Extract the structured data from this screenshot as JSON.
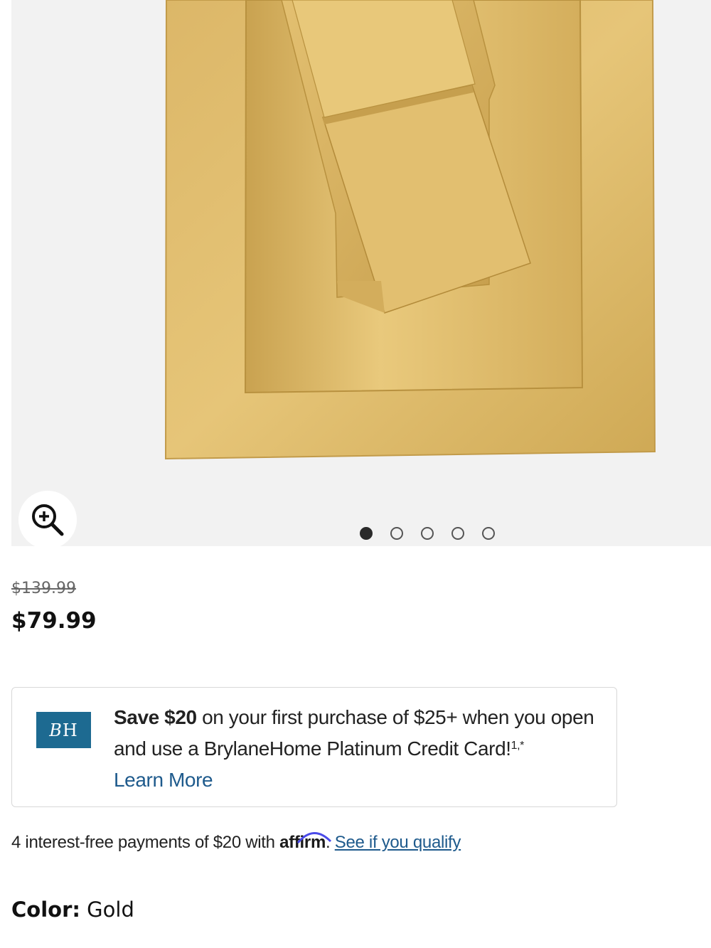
{
  "gallery": {
    "image_alt": "Gold satin sheet set",
    "slide_count": 5,
    "active_slide": 1
  },
  "pricing": {
    "original_price": "$139.99",
    "sale_price": "$79.99"
  },
  "promo": {
    "logo_text_1": "B",
    "logo_text_2": "H",
    "headline_bold": "Save $20",
    "headline_rest": " on your first purchase of $25+ when you open and use a BrylaneHome Platinum Credit Card!",
    "footnote": "1,*",
    "learn_more": "Learn More",
    "logo_color": "#1d6a91"
  },
  "financing": {
    "text": "4 interest-free payments of $20 with ",
    "brand": "affirm",
    "after_brand": ". ",
    "link": "See if you qualify"
  },
  "color": {
    "label": "Color:",
    "value": " Gold"
  },
  "colors": {
    "link": "#1e5a8c",
    "gold": "#d9b35f"
  }
}
